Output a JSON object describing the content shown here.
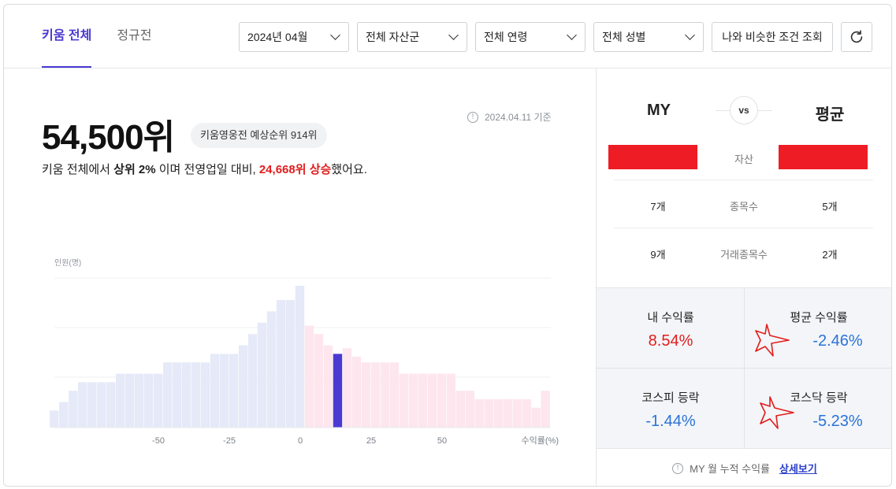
{
  "tabs": [
    {
      "label": "키움 전체",
      "active": true
    },
    {
      "label": "정규전",
      "active": false
    }
  ],
  "filters": {
    "month": "2024년 04월",
    "asset_group": "전체 자산군",
    "age": "전체 연령",
    "gender": "전체 성별"
  },
  "similar_button": "나와 비슷한 조건 조회",
  "refresh_icon": "refresh-icon",
  "rank": {
    "value": "54,500위",
    "badge": "키움영웅전 예상순위 914위",
    "as_of": "2024.04.11 기준",
    "summary_prefix": "키움 전체에서 ",
    "summary_top": "상위 2%",
    "summary_mid": " 이며 전영업일 대비, ",
    "summary_change": "24,668위 상승",
    "summary_suffix": "했어요."
  },
  "chart_data": {
    "type": "bar",
    "ylabel": "인원(명)",
    "xlabel": "수익률(%)",
    "x_ticks": [
      "-50",
      "-25",
      "0",
      "25",
      "50"
    ],
    "bin_width_pct": 3.33,
    "bins_start_pct": -88.3,
    "values": [
      12,
      18,
      26,
      32,
      32,
      32,
      32,
      38,
      38,
      38,
      38,
      38,
      46,
      46,
      46,
      46,
      46,
      52,
      52,
      52,
      58,
      66,
      74,
      82,
      90,
      90,
      100,
      72,
      66,
      58,
      52,
      56,
      50,
      46,
      46,
      46,
      46,
      38,
      38,
      38,
      38,
      38,
      38,
      26,
      26,
      20,
      20,
      20,
      20,
      20,
      20,
      14,
      26
    ],
    "highlight_index": 30,
    "colors": {
      "negative": "#e6e9f8",
      "positive": "#fde6ee",
      "highlight": "#4a3ad1"
    }
  },
  "compare": {
    "my_label": "MY",
    "vs_label": "vs",
    "avg_label": "평균",
    "asset_label": "자산",
    "rows": [
      {
        "label": "종목수",
        "my": "7개",
        "avg": "5개"
      },
      {
        "label": "거래종목수",
        "my": "9개",
        "avg": "2개"
      }
    ]
  },
  "stats": {
    "my_return_label": "내 수익률",
    "my_return": "8.54%",
    "avg_return_label": "평균 수익률",
    "avg_return": "-2.46%",
    "kospi_label": "코스피 등락",
    "kospi": "-1.44%",
    "kosdaq_label": "코스닥 등락",
    "kosdaq": "-5.23%"
  },
  "footer": {
    "text": "MY 월 누적 수익률",
    "link": "상세보기"
  }
}
